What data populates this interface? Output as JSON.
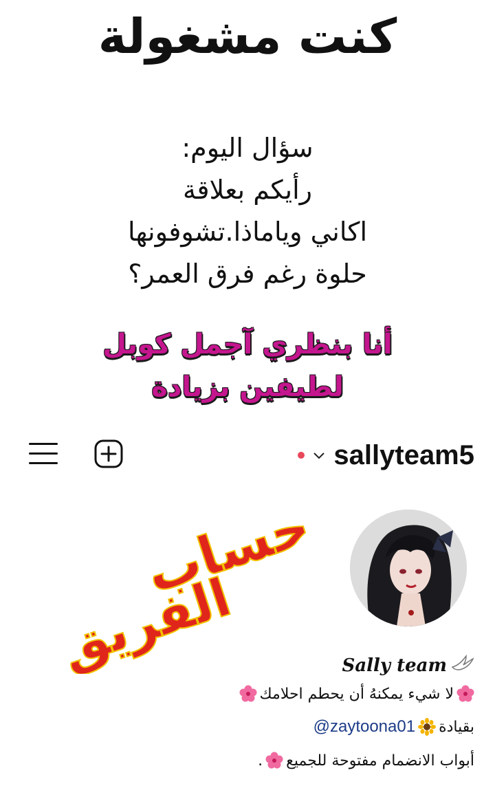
{
  "title": "كنت مشغولة",
  "question": {
    "lines": [
      "سؤال اليوم:",
      "رأيكم بعلاقة",
      "اكاني وياماذا.تشوفونها",
      "حلوة رغم فرق العمر؟"
    ]
  },
  "answer": {
    "lines": [
      "أنا بنظري آجمل كوبل",
      "لطيفين بزيادة"
    ]
  },
  "header": {
    "username": "sallyteam5",
    "menu_icon": "hamburger-icon",
    "add_icon": "plus-square-icon"
  },
  "calligraphy_text": "حساب الفريق",
  "bio": {
    "name": "Sally team",
    "line1": "لا شيء يمكنهُ أن يحطم احلامك",
    "line2_prefix": "بقيادة",
    "mention": "@zaytoona01",
    "line3": "أبواب الانضمام مفتوحة للجميع",
    "line3_suffix": "."
  },
  "colors": {
    "accent_pink": "#c4168e",
    "calligraphy_red": "#e0261b",
    "status_dot": "#e8485a",
    "mention_blue": "#1d3c87"
  }
}
